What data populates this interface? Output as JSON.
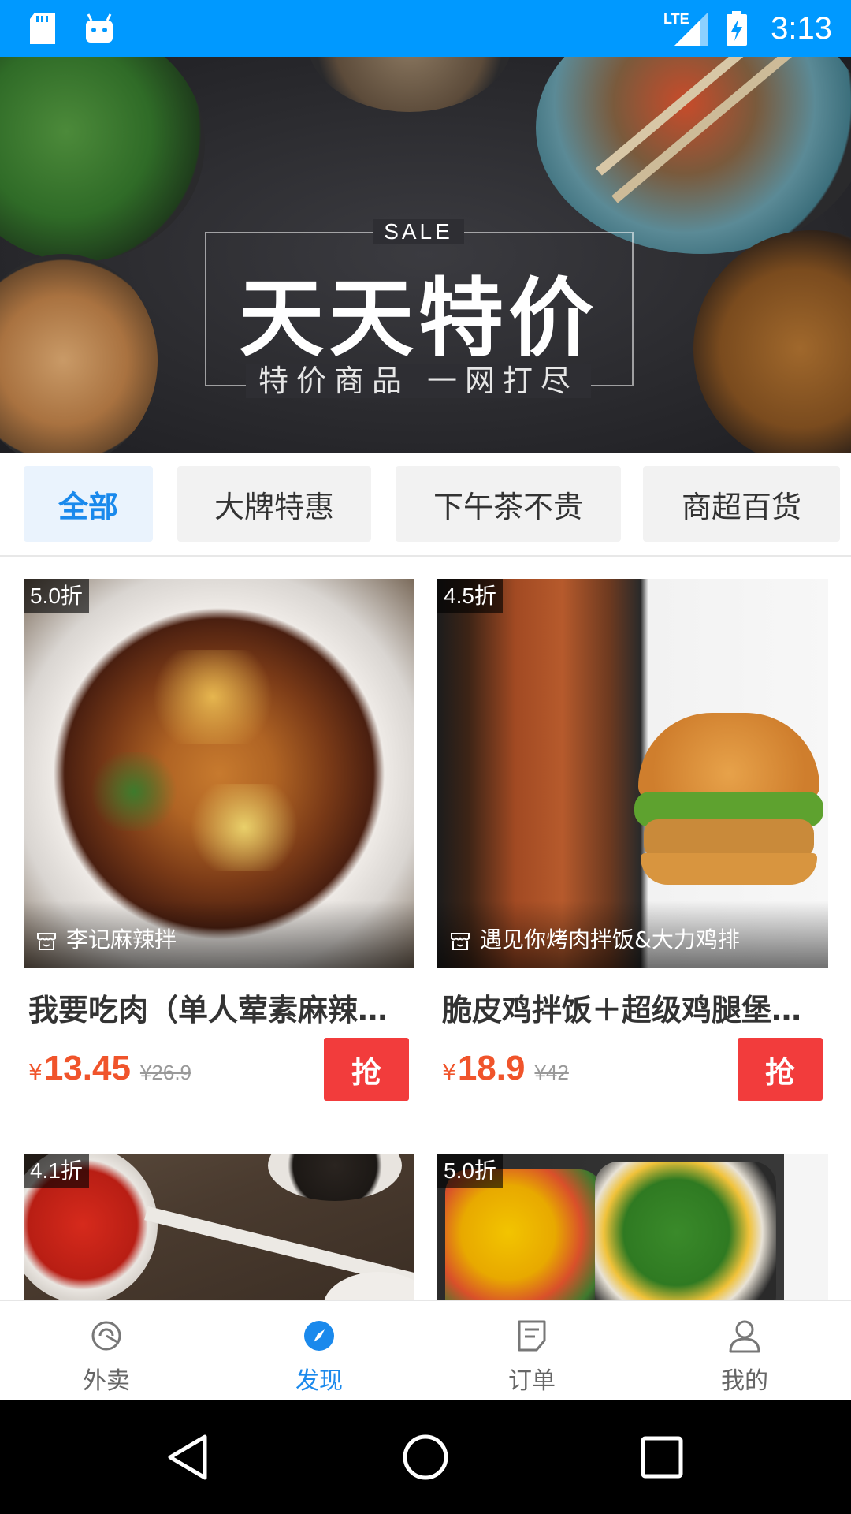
{
  "status_bar": {
    "time": "3:13",
    "network": "LTE",
    "icons": [
      "sd-card-icon",
      "android-icon",
      "signal-icon",
      "battery-charging-icon"
    ]
  },
  "banner": {
    "sale": "SALE",
    "title": "天天特价",
    "subtitle": "特价商品 一网打尽"
  },
  "tabs": [
    {
      "label": "全部",
      "active": true
    },
    {
      "label": "大牌特惠",
      "active": false
    },
    {
      "label": "下午茶不贵",
      "active": false
    },
    {
      "label": "商超百货",
      "active": false
    }
  ],
  "products": [
    {
      "discount": "5.0折",
      "shop": "李记麻辣拌",
      "title": "我要吃肉（单人荤素麻辣…",
      "currency": "¥",
      "price": "13.45",
      "original_price": "¥26.9",
      "grab": "抢"
    },
    {
      "discount": "4.5折",
      "shop": "遇见你烤肉拌饭&大力鸡排",
      "title": "脆皮鸡拌饭＋超级鸡腿堡…",
      "currency": "¥",
      "price": "18.9",
      "original_price": "¥42",
      "grab": "抢"
    },
    {
      "discount": "4.1折"
    },
    {
      "discount": "5.0折"
    }
  ],
  "bottom_nav": [
    {
      "label": "外卖",
      "icon": "takeout-icon",
      "active": false
    },
    {
      "label": "发现",
      "icon": "compass-icon",
      "active": true
    },
    {
      "label": "订单",
      "icon": "order-icon",
      "active": false
    },
    {
      "label": "我的",
      "icon": "profile-icon",
      "active": false
    }
  ],
  "colors": {
    "status_bar": "#0099ff",
    "accent": "#1a89ec",
    "price": "#f0542b",
    "grab_button": "#f23c3c"
  }
}
